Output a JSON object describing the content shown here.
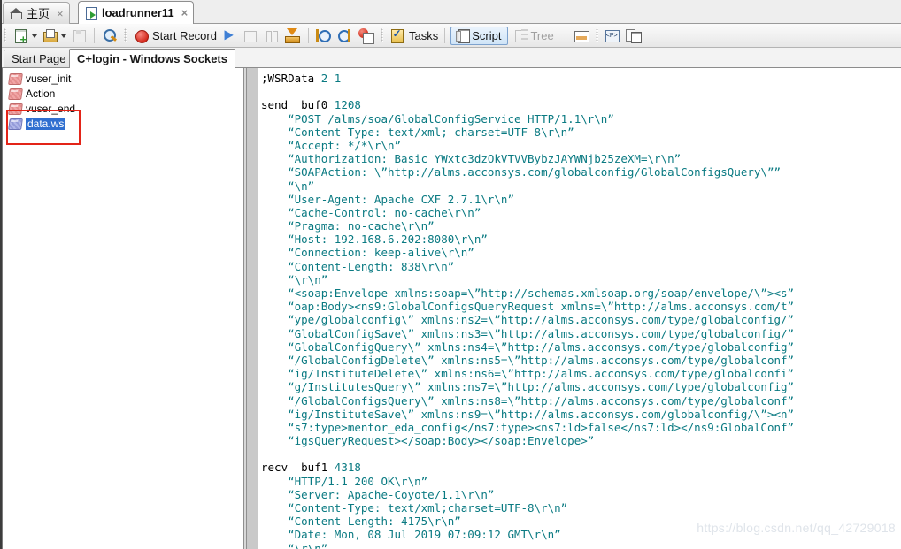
{
  "window_tabs": [
    {
      "label": "主页",
      "icon": "home-icon",
      "close": "×",
      "active": false
    },
    {
      "label": "loadrunner11",
      "icon": "script-run-icon",
      "close": "×",
      "active": true
    }
  ],
  "toolbar": {
    "groups": [
      {
        "items": [
          {
            "kind": "icon",
            "name": "new-script-icon",
            "glyph": "g-newscript"
          },
          {
            "kind": "caret",
            "name": "new-script-dropdown"
          },
          {
            "kind": "icon",
            "name": "open-script-icon",
            "glyph": "g-open"
          },
          {
            "kind": "caret",
            "name": "open-script-dropdown"
          },
          {
            "kind": "icon",
            "name": "save-icon",
            "glyph": "g-save",
            "disabled": true
          },
          {
            "kind": "sep"
          },
          {
            "kind": "icon",
            "name": "find-icon",
            "glyph": "g-find"
          }
        ]
      },
      {
        "items": [
          {
            "kind": "icon",
            "name": "record-icon",
            "glyph": "g-record"
          },
          {
            "kind": "text",
            "name": "start-record-label",
            "label": "Start Record"
          },
          {
            "kind": "icon",
            "name": "replay-play-icon",
            "glyph": "g-play"
          },
          {
            "kind": "icon",
            "name": "stop-icon",
            "glyph": "g-stop",
            "disabled": true
          },
          {
            "kind": "icon",
            "name": "pause-icon",
            "glyph": "g-pause",
            "disabled": true
          },
          {
            "kind": "icon",
            "name": "download-tray-icon",
            "glyph": "g-tray"
          },
          {
            "kind": "sep"
          },
          {
            "kind": "icon",
            "name": "step-into-icon",
            "glyph": "g-step"
          },
          {
            "kind": "icon",
            "name": "step-out-icon",
            "glyph": "g-step2"
          },
          {
            "kind": "icon",
            "name": "run-step-icon",
            "glyph": "g-runstep"
          }
        ]
      },
      {
        "items": [
          {
            "kind": "icon",
            "name": "tasks-icon",
            "glyph": "g-tasks"
          },
          {
            "kind": "text",
            "name": "tasks-label",
            "label": "Tasks"
          },
          {
            "kind": "sep"
          },
          {
            "kind": "framed",
            "name": "script-view-button",
            "glyph": "g-scriptdoc",
            "label": "Script"
          },
          {
            "kind": "iconlabel",
            "name": "tree-view-button",
            "glyph": "g-tree",
            "label": "Tree",
            "disabled": true
          },
          {
            "kind": "sep"
          },
          {
            "kind": "icon",
            "name": "split-pane-icon",
            "glyph": "g-pane"
          }
        ]
      },
      {
        "items": [
          {
            "kind": "icon",
            "name": "snapshot-icon",
            "glyph": "g-snap"
          },
          {
            "kind": "icon",
            "name": "copy-docs-icon",
            "glyph": "g-docs"
          }
        ]
      }
    ]
  },
  "doc_tabs": [
    {
      "label": "Start Page",
      "active": false
    },
    {
      "label": "C+login - Windows Sockets",
      "active": true
    }
  ],
  "tree": {
    "nodes": [
      {
        "label": "vuser_init",
        "icon": "action-brick-icon",
        "selected": false
      },
      {
        "label": "Action",
        "icon": "action-brick-icon",
        "selected": false
      },
      {
        "label": "vuser_end",
        "icon": "action-brick-icon",
        "selected": false
      },
      {
        "label": "data.ws",
        "icon": "data-brick-icon",
        "selected": true
      }
    ],
    "annotation_color": "#e32418"
  },
  "colors": {
    "string_teal": "#0a7a82",
    "keyword_black": "#000000",
    "selection_blue": "#2f6fd0",
    "annotation_red": "#e32418"
  },
  "code": {
    "lines": [
      [
        {
          "t": "kw",
          "s": ";WSRData "
        },
        {
          "t": "num",
          "s": "2 1"
        }
      ],
      [
        {
          "t": "kw",
          "s": ""
        }
      ],
      [
        {
          "t": "kw",
          "s": "send  buf0 "
        },
        {
          "t": "num",
          "s": "1208"
        }
      ],
      [
        {
          "t": "str",
          "s": "    “POST /alms/soa/GlobalConfigService HTTP/1.1\\r\\n”"
        }
      ],
      [
        {
          "t": "str",
          "s": "    “Content-Type: text/xml; charset=UTF-8\\r\\n”"
        }
      ],
      [
        {
          "t": "str",
          "s": "    “Accept: */*\\r\\n”"
        }
      ],
      [
        {
          "t": "str",
          "s": "    “Authorization: Basic YWxtc3dzOkVTVVBybzJAYWNjb25zeXM=\\r\\n”"
        }
      ],
      [
        {
          "t": "str",
          "s": "    “SOAPAction: \\”http://alms.acconsys.com/globalconfig/GlobalConfigsQuery\\””"
        }
      ],
      [
        {
          "t": "str",
          "s": "    “\\n”"
        }
      ],
      [
        {
          "t": "str",
          "s": "    “User-Agent: Apache CXF 2.7.1\\r\\n”"
        }
      ],
      [
        {
          "t": "str",
          "s": "    “Cache-Control: no-cache\\r\\n”"
        }
      ],
      [
        {
          "t": "str",
          "s": "    “Pragma: no-cache\\r\\n”"
        }
      ],
      [
        {
          "t": "str",
          "s": "    “Host: 192.168.6.202:8080\\r\\n”"
        }
      ],
      [
        {
          "t": "str",
          "s": "    “Connection: keep-alive\\r\\n”"
        }
      ],
      [
        {
          "t": "str",
          "s": "    “Content-Length: 838\\r\\n”"
        }
      ],
      [
        {
          "t": "str",
          "s": "    “\\r\\n”"
        }
      ],
      [
        {
          "t": "str",
          "s": "    “<soap:Envelope xmlns:soap=\\”http://schemas.xmlsoap.org/soap/envelope/\\”><s”"
        }
      ],
      [
        {
          "t": "str",
          "s": "    “oap:Body><ns9:GlobalConfigsQueryRequest xmlns=\\”http://alms.acconsys.com/t”"
        }
      ],
      [
        {
          "t": "str",
          "s": "    “ype/globalconfig\\” xmlns:ns2=\\”http://alms.acconsys.com/type/globalconfig/”"
        }
      ],
      [
        {
          "t": "str",
          "s": "    “GlobalConfigSave\\” xmlns:ns3=\\”http://alms.acconsys.com/type/globalconfig/”"
        }
      ],
      [
        {
          "t": "str",
          "s": "    “GlobalConfigQuery\\” xmlns:ns4=\\”http://alms.acconsys.com/type/globalconfig”"
        }
      ],
      [
        {
          "t": "str",
          "s": "    “/GlobalConfigDelete\\” xmlns:ns5=\\”http://alms.acconsys.com/type/globalconf”"
        }
      ],
      [
        {
          "t": "str",
          "s": "    “ig/InstituteDelete\\” xmlns:ns6=\\”http://alms.acconsys.com/type/globalconfi”"
        }
      ],
      [
        {
          "t": "str",
          "s": "    “g/InstitutesQuery\\” xmlns:ns7=\\”http://alms.acconsys.com/type/globalconfig”"
        }
      ],
      [
        {
          "t": "str",
          "s": "    “/GlobalConfigsQuery\\” xmlns:ns8=\\”http://alms.acconsys.com/type/globalconf”"
        }
      ],
      [
        {
          "t": "str",
          "s": "    “ig/InstituteSave\\” xmlns:ns9=\\”http://alms.acconsys.com/globalconfig/\\”><n”"
        }
      ],
      [
        {
          "t": "str",
          "s": "    “s7:type>mentor_eda_config</ns7:type><ns7:ld>false</ns7:ld></ns9:GlobalConf”"
        }
      ],
      [
        {
          "t": "str",
          "s": "    “igsQueryRequest></soap:Body></soap:Envelope>”"
        }
      ],
      [
        {
          "t": "kw",
          "s": ""
        }
      ],
      [
        {
          "t": "kw",
          "s": "recv  buf1 "
        },
        {
          "t": "num",
          "s": "4318"
        }
      ],
      [
        {
          "t": "str",
          "s": "    “HTTP/1.1 200 OK\\r\\n”"
        }
      ],
      [
        {
          "t": "str",
          "s": "    “Server: Apache-Coyote/1.1\\r\\n”"
        }
      ],
      [
        {
          "t": "str",
          "s": "    “Content-Type: text/xml;charset=UTF-8\\r\\n”"
        }
      ],
      [
        {
          "t": "str",
          "s": "    “Content-Length: 4175\\r\\n”"
        }
      ],
      [
        {
          "t": "str",
          "s": "    “Date: Mon, 08 Jul 2019 07:09:12 GMT\\r\\n”"
        }
      ],
      [
        {
          "t": "str",
          "s": "    “\\r\\n”"
        }
      ]
    ]
  },
  "watermark": "https://blog.csdn.net/qq_42729018"
}
